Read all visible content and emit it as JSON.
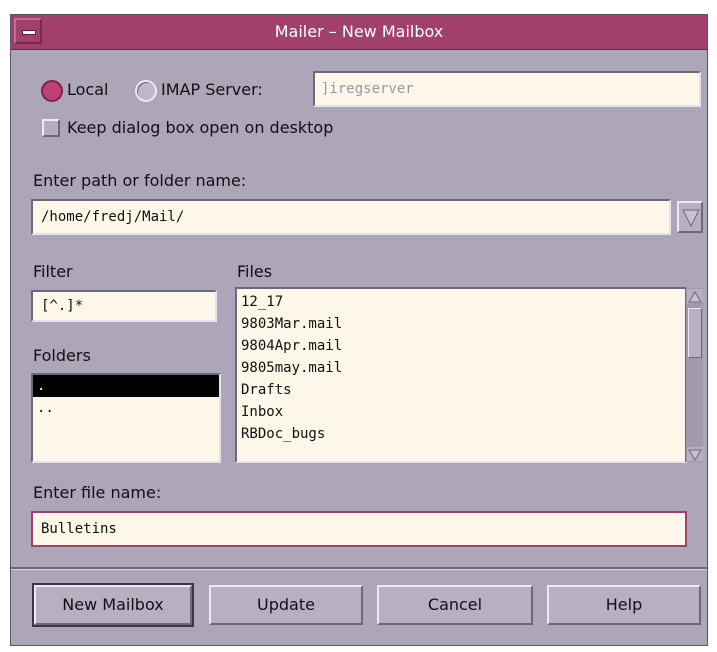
{
  "window": {
    "title": "Mailer – New Mailbox"
  },
  "source": {
    "local_label": "Local",
    "imap_label": "IMAP Server:",
    "imap_server_value": "]iregserver",
    "selected": "Local"
  },
  "keep_open_label": "Keep dialog box open on desktop",
  "path": {
    "label": "Enter path or folder name:",
    "value": "/home/fredj/Mail/"
  },
  "filter": {
    "label": "Filter",
    "value": "[^.]*"
  },
  "folders": {
    "label": "Folders",
    "items": [
      ".",
      ".."
    ]
  },
  "files": {
    "label": "Files",
    "items": [
      "12_17",
      "9803Mar.mail",
      "9804Apr.mail",
      "9805may.mail",
      "Drafts",
      "Inbox",
      "RBDoc_bugs"
    ]
  },
  "filename": {
    "label": "Enter file name:",
    "value": "Bulletins"
  },
  "buttons": {
    "new_mailbox": "New Mailbox",
    "update": "Update",
    "cancel": "Cancel",
    "help": "Help"
  },
  "colors": {
    "titlebar": "#a13f6d",
    "dialog_bg": "#ada5b8",
    "field_bg": "#fdf7e9",
    "radio_selected": "#c03f75"
  },
  "icons": {
    "window_menu": "window-menu-icon",
    "dropdown": "dropdown-triangle-icon",
    "scroll_up": "scroll-up-arrow-icon",
    "scroll_down": "scroll-down-arrow-icon"
  }
}
